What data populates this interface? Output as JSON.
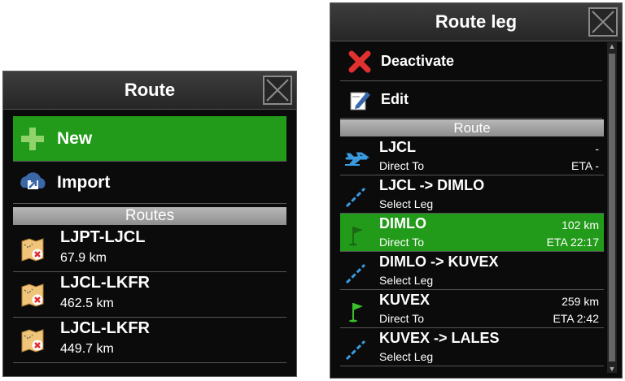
{
  "left_panel": {
    "title": "Route",
    "actions": [
      {
        "label": "New",
        "icon": "plus-icon"
      },
      {
        "label": "Import",
        "icon": "import-icon"
      }
    ],
    "section_title": "Routes",
    "routes": [
      {
        "name": "LJPT-LJCL",
        "distance": "67.9 km"
      },
      {
        "name": "LJCL-LKFR",
        "distance": "462.5 km"
      },
      {
        "name": "LJCL-LKFR",
        "distance": "449.7 km"
      }
    ]
  },
  "right_panel": {
    "title": "Route leg",
    "actions": [
      {
        "label": "Deactivate",
        "icon": "red-x-icon"
      },
      {
        "label": "Edit",
        "icon": "edit-icon"
      }
    ],
    "section_title": "Route",
    "legs": [
      {
        "name": "LJCL",
        "sub": "Direct To",
        "right_top": "-",
        "right_bottom": "ETA -",
        "icon": "airplane-icon"
      },
      {
        "name": "LJCL -> DIMLO",
        "sub": "Select Leg",
        "right_top": "",
        "right_bottom": "",
        "icon": "leg-line-icon"
      },
      {
        "name": "DIMLO",
        "sub": "Direct To",
        "right_top": "102 km",
        "right_bottom": "ETA 22:17",
        "icon": "flag-icon",
        "selected": true
      },
      {
        "name": "DIMLO -> KUVEX",
        "sub": "Select Leg",
        "right_top": "",
        "right_bottom": "",
        "icon": "leg-line-icon"
      },
      {
        "name": "KUVEX",
        "sub": "Direct To",
        "right_top": "259 km",
        "right_bottom": "ETA 2:42",
        "icon": "flag-icon"
      },
      {
        "name": "KUVEX -> LALES",
        "sub": "Select Leg",
        "right_top": "",
        "right_bottom": "",
        "icon": "leg-line-icon"
      }
    ]
  },
  "colors": {
    "selected": "#239b1a",
    "background": "#0b0b0b",
    "section": "#a0a0a0",
    "delete_red": "#e03030"
  }
}
